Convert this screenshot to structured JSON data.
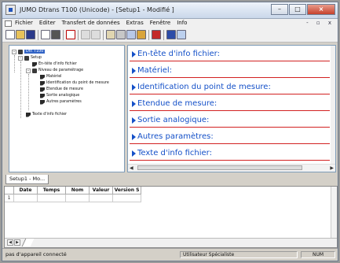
{
  "window": {
    "title": "JUMO Dtrans T100 (Unicode) - [Setup1 - Modifié ]",
    "caption_buttons": [
      "minimize-icon",
      "maximize-icon",
      "close-icon"
    ]
  },
  "menubar": {
    "items": [
      "Fichier",
      "Editer",
      "Transfert de données",
      "Extras",
      "Fenêtre",
      "Info"
    ],
    "mdi_buttons": "- ▫ x"
  },
  "toolbar": {
    "icons": [
      "new-file-icon",
      "open-folder-icon",
      "save-icon",
      "print-preview-icon",
      "print-icon",
      "draw-icon",
      "undo-icon",
      "redo-icon",
      "connect-icon",
      "setup-icon",
      "transfer-icon",
      "manual-icon",
      "layout-icon",
      "info-icon"
    ]
  },
  "tree": {
    "items": [
      {
        "label": "Dtr. T100",
        "level": 0,
        "expander": "-",
        "icon": "device-icon",
        "selected": true
      },
      {
        "label": "Setup",
        "level": 1,
        "expander": "-",
        "icon": "setup-icon"
      },
      {
        "label": "En-tête d'info fichier",
        "level": 2,
        "icon": "file-info-icon"
      },
      {
        "label": "Niveau de paramétrage",
        "level": 2,
        "expander": "-",
        "icon": "folder-icon"
      },
      {
        "label": "Matériel",
        "level": 3,
        "icon": "parameter-icon"
      },
      {
        "label": "Identification du point de mesure",
        "level": 3,
        "icon": "parameter-icon"
      },
      {
        "label": "Etendue de mesure",
        "level": 3,
        "icon": "parameter-icon"
      },
      {
        "label": "Sortie analogique",
        "level": 3,
        "icon": "parameter-icon"
      },
      {
        "label": "Autres paramètres",
        "level": 3,
        "icon": "parameter-icon"
      },
      {
        "label": "Texte d'info fichier",
        "level": 1,
        "icon": "file-text-icon"
      }
    ]
  },
  "sections": [
    "En-tête d'info fichier:",
    "Matériel:",
    "Identification du point de mesure:",
    "Etendue de mesure:",
    "Sortie analogique:",
    "Autres paramètres:",
    "Texte d'info fichier:"
  ],
  "document_tabs": [
    "Setup1 - Mo..."
  ],
  "grid": {
    "columns": [
      "",
      "Date",
      "Temps",
      "Nom",
      "Valeur",
      "Version S"
    ],
    "rows": [
      [
        "1",
        "",
        "",
        "",
        "",
        ""
      ]
    ]
  },
  "statusbar": {
    "message": "pas d'appareil connecté",
    "user": "Utilisateur Spécialiste",
    "mode": "NUM"
  },
  "colors": {
    "section_text": "#1450c8",
    "section_line": "#d22222",
    "tree_selection": "#3163c5"
  }
}
